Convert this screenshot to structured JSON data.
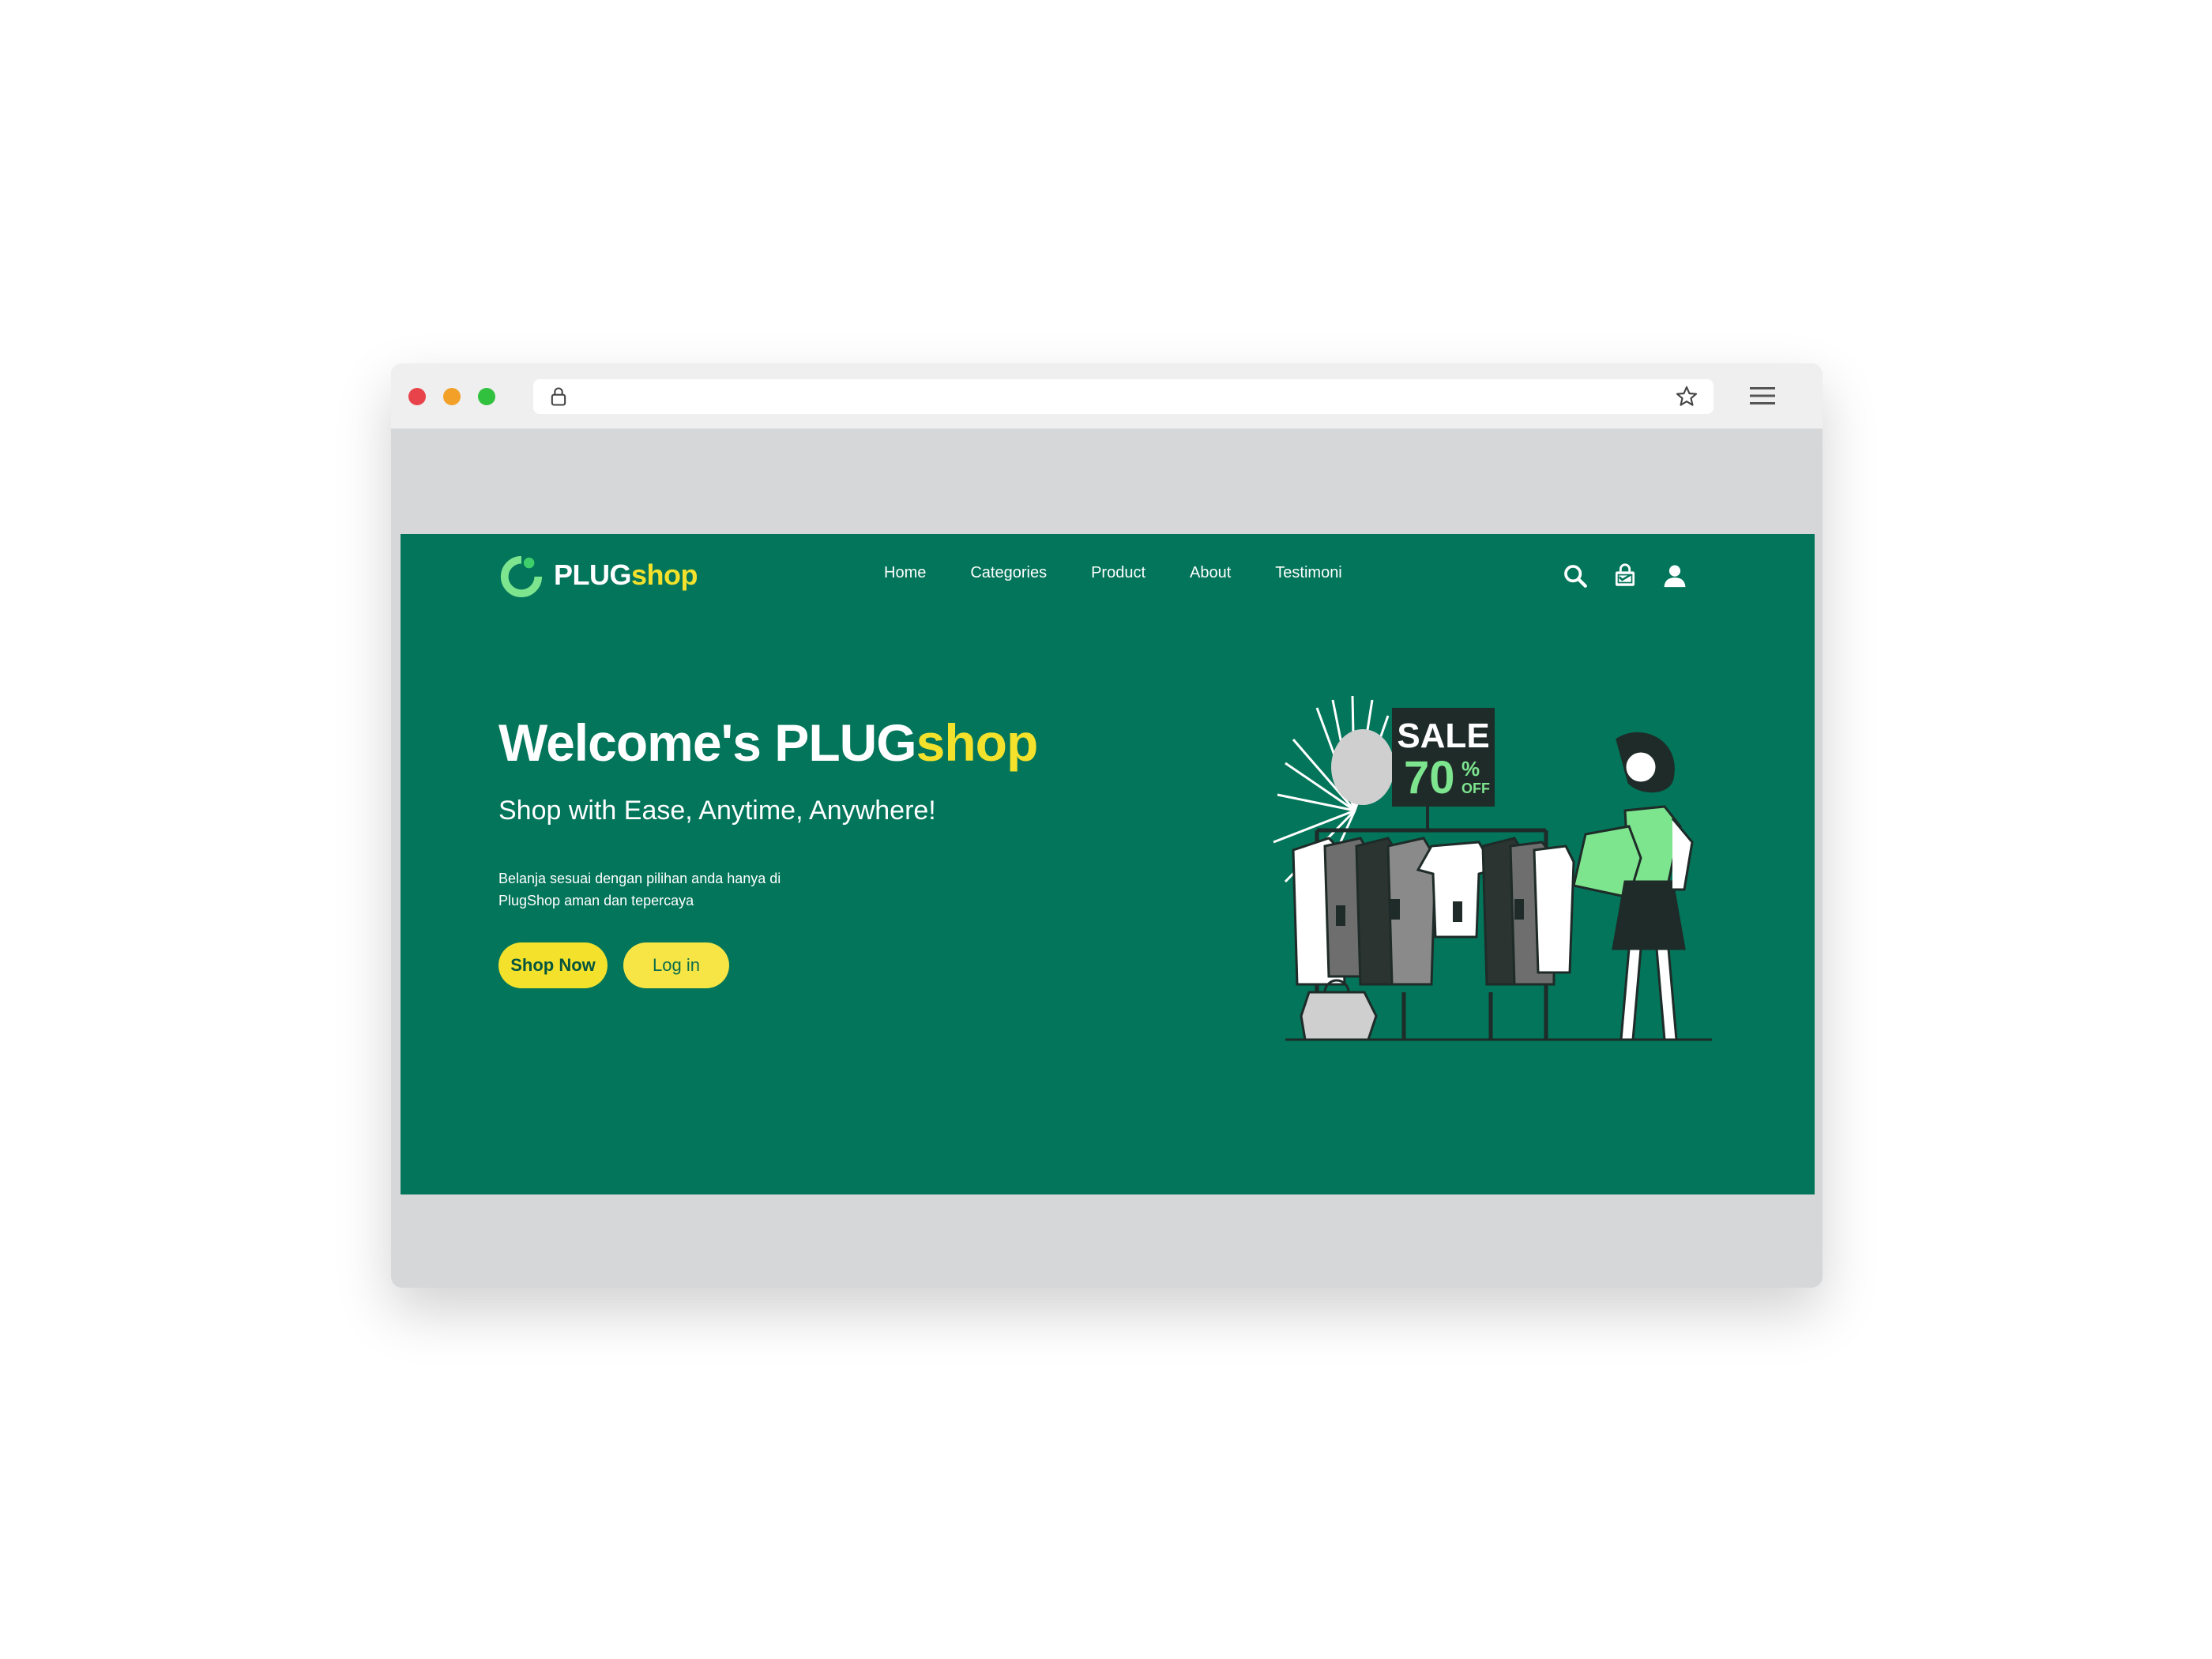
{
  "browser": {
    "icons": [
      "lock-icon",
      "star-icon",
      "hamburger-menu-icon"
    ]
  },
  "logo": {
    "primary": "PLUG",
    "accent": "shop"
  },
  "nav": {
    "items": [
      "Home",
      "Categories",
      "Product",
      "About",
      "Testimoni"
    ],
    "icons": [
      "search-icon",
      "shopping-bag-icon",
      "user-icon"
    ]
  },
  "hero": {
    "title_primary": "Welcome's PLUG",
    "title_accent": "shop",
    "subtitle": "Shop with Ease, Anytime, Anywhere!",
    "description_line1": "Belanja sesuai dengan pilihan anda hanya di",
    "description_line2": "PlugShop aman dan tepercaya",
    "shop_button": "Shop Now",
    "login_button": "Log in"
  },
  "illustration": {
    "sale_label": "SALE",
    "discount_number": "70",
    "discount_percent": "%",
    "discount_off": "OFF",
    "tag_text": "SALE"
  },
  "colors": {
    "page_background": "#02755a",
    "accent_yellow": "#f4e12b",
    "illustration_green": "#7ee58f"
  }
}
